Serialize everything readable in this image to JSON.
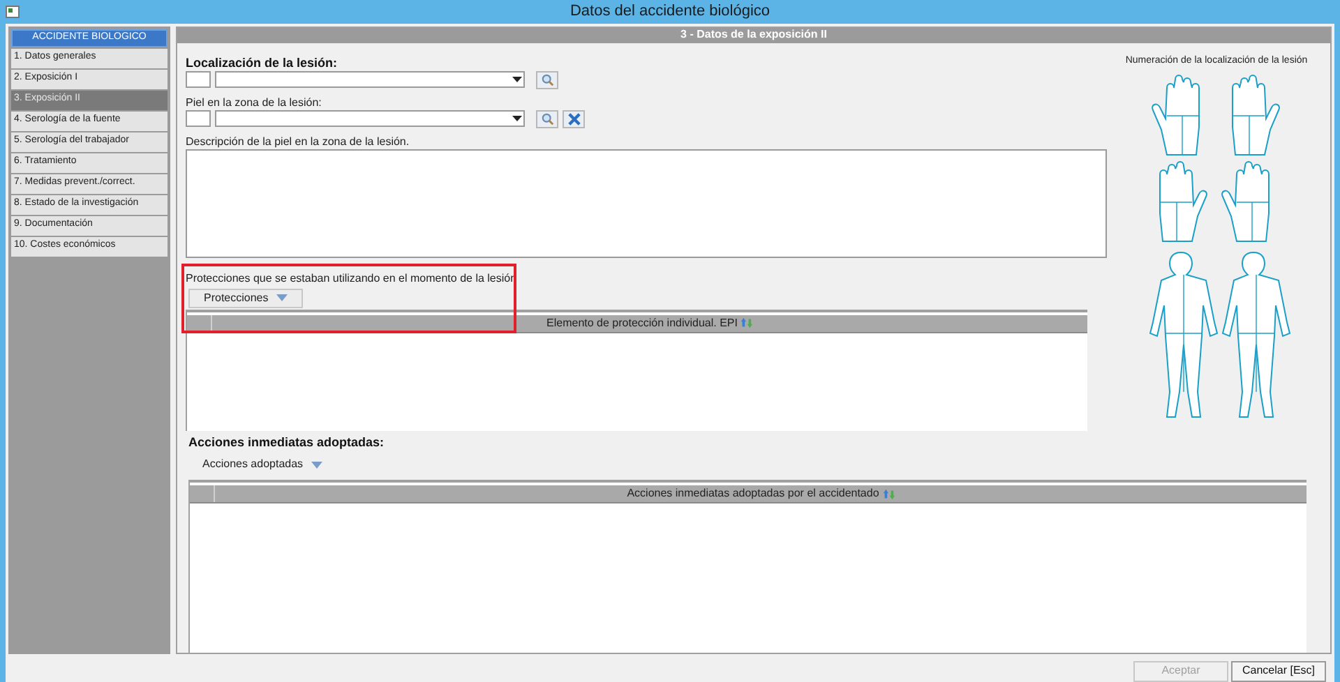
{
  "window": {
    "title": "Datos del accidente biológico"
  },
  "sidebar": {
    "header": "ACCIDENTE BIOLOGICO",
    "items": [
      {
        "label": "1. Datos generales",
        "selected": false
      },
      {
        "label": "2. Exposición I",
        "selected": false
      },
      {
        "label": "3. Exposición II",
        "selected": true
      },
      {
        "label": "4. Serología de la fuente",
        "selected": false
      },
      {
        "label": "5. Serología del trabajador",
        "selected": false
      },
      {
        "label": "6. Tratamiento",
        "selected": false
      },
      {
        "label": "7. Medidas prevent./correct.",
        "selected": false
      },
      {
        "label": "8. Estado de la investigación",
        "selected": false
      },
      {
        "label": "9. Documentación",
        "selected": false
      },
      {
        "label": "10. Costes económicos",
        "selected": false
      }
    ]
  },
  "section_title": "3 - Datos de la exposición II",
  "lesion_location": {
    "label": "Localización de la lesión:"
  },
  "skin_zone": {
    "label": "Piel en la zona de la lesión:"
  },
  "skin_description": {
    "label": "Descripción de la piel en la zona de la lesión."
  },
  "protections": {
    "label": "Protecciones que se estaban utilizando en el momento de la lesión",
    "menu_button": "Protecciones",
    "highlighted": true,
    "table": {
      "columns": [
        "Elemento de protección individual. EPI"
      ]
    }
  },
  "diagram": {
    "title": "Numeración de la localización de la lesión"
  },
  "actions": {
    "label": "Acciones inmediatas adoptadas:",
    "menu_button": "Acciones adoptadas",
    "table": {
      "columns": [
        "Acciones inmediatas adoptadas por el accidentado"
      ]
    }
  },
  "buttons": [
    {
      "label": "Aceptar",
      "disabled": true
    },
    {
      "label": "Cancelar [Esc]",
      "disabled": false
    }
  ]
}
